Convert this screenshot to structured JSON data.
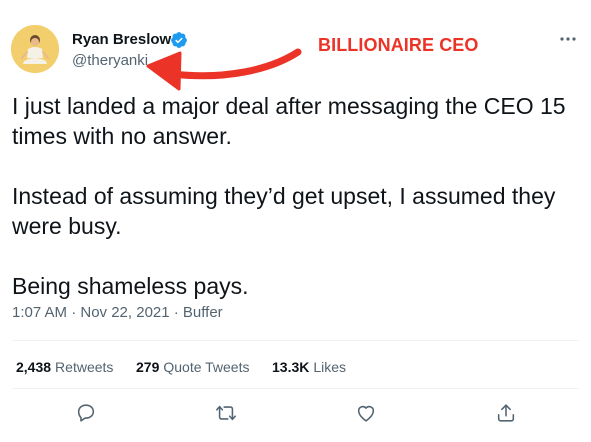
{
  "author": {
    "display_name": "Ryan Breslow",
    "handle": "@theryanki",
    "avatar_icon": "avatar-meditating-man",
    "verified_icon": "verified-badge-icon"
  },
  "annotation": {
    "label": "BILLIONAIRE CEO",
    "color": "#ec3327"
  },
  "tweet": {
    "paragraphs": [
      "I just landed a major deal after messaging the CEO 15 times with no answer.",
      "Instead of assuming they’d get upset, I assumed they were busy.",
      "Being shameless pays."
    ],
    "timestamp": "1:07 AM · Nov 22, 2021 · Buffer"
  },
  "stats": {
    "retweets_count": "2,438",
    "retweets_label": "Retweets",
    "quotes_count": "279",
    "quotes_label": "Quote Tweets",
    "likes_count": "13.3K",
    "likes_label": "Likes"
  },
  "actions": [
    "reply-icon",
    "retweet-icon",
    "like-icon",
    "share-icon"
  ],
  "colors": {
    "text": "#0f1419",
    "secondary": "#536471",
    "verified": "#1d9bf0",
    "avatar_bg": "#f2cf6c"
  }
}
